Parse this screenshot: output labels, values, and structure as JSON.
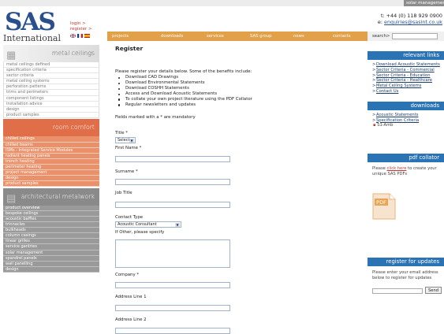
{
  "top_tab": "solar management",
  "logo": {
    "brand": "SAS",
    "sub": "International"
  },
  "auth": {
    "login": "login >",
    "register": "register >"
  },
  "contact": {
    "phone": "t: +44 (0) 118 929 0900",
    "email_prefix": "e:",
    "email": "enquiries@sasint.co.uk"
  },
  "nav": [
    "projects",
    "downloads",
    "services",
    "SAS group",
    "news",
    "contacts"
  ],
  "search": {
    "label": "search>"
  },
  "sidebar": {
    "metal_title": "metal ceilings",
    "metal_items": [
      "metal ceilings defined",
      "specification criteria",
      "sector criteria",
      "metal ceiling systems",
      "perforation patterns",
      "trims and perimeters",
      "component listings",
      "installation advice",
      "design",
      "product samples"
    ],
    "room_title": "room comfort",
    "room_items": [
      "chilled ceilings",
      "chilled beams",
      "ISMs - Integrated Service Modules",
      "radiant heating panels",
      "trench heating",
      "perimeter heating",
      "project management",
      "design",
      "product samples"
    ],
    "arch_title": "architectural metalwork",
    "arch_items": [
      "product overview",
      "bespoke ceilings",
      "acoustic baffles",
      "trinnacles",
      "bulkheads",
      "column casings",
      "linear grilles",
      "service gantries",
      "solar management",
      "spandrel panels",
      "wall panelling",
      "design"
    ]
  },
  "main": {
    "title": "Register",
    "intro": "Please register your details below. Some of the benefits include:",
    "benefits": [
      "Download CAD Drawings",
      "Download Environmental Statements",
      "Download COSHH Statements",
      "Access and Download Acoustic Statements",
      "To collate your own project literature using the PDF Collator",
      "Regular newsletters and updates"
    ],
    "mandatory": "Fields marked with a * are mandatory",
    "title_label": "Title *",
    "title_value": "Select",
    "first_name": "First Name *",
    "surname": "Surname *",
    "job_title": "Job Title",
    "contact_type": "Contact Type",
    "contact_type_value": "Acoustic Consultant",
    "other": "If Other, please specify",
    "company": "Company *",
    "address1": "Address Line 1",
    "address2": "Address Line 2"
  },
  "right": {
    "relevant_title": "relevant links",
    "relevant_links": [
      "Download Acoustic Statements",
      "Sector Criteria - Commercial",
      "Sector Criteria - Education",
      "Sector Criteria - Healthcare",
      "Metal Ceiling Systems",
      "Contact Us"
    ],
    "downloads_title": "downloads",
    "downloads_links": [
      "Acoustic Statements",
      "Specification Criteria"
    ],
    "download_file": "S1-Amb",
    "pdf_title": "pdf collator",
    "pdf_text_pre": "Please",
    "pdf_link": "click here",
    "pdf_text_post": "to create your unique SAS PDFs",
    "pdf_icon_label": "PDF",
    "register_title": "register for updates",
    "register_text": "Please enter your email address below to register for updates",
    "send": "Send"
  },
  "colors": {
    "nav": "#e2a048",
    "blue": "#2a74b6",
    "room": "#e06e48",
    "arch": "#8a8a8a"
  }
}
